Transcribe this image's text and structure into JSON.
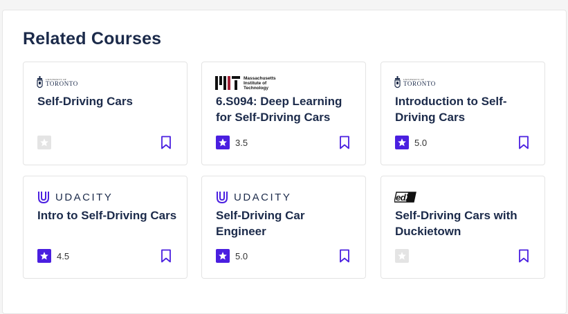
{
  "section": {
    "title": "Related Courses"
  },
  "colors": {
    "accent": "#4a1fe0",
    "title": "#1b2a4a",
    "empty_star": "#e4e4e4"
  },
  "courses": [
    {
      "provider": "University of Toronto",
      "logo": {
        "icon": "uoft-crest-icon",
        "small": "UNIVERSITY OF",
        "big": "TORONTO"
      },
      "title": "Self-Driving Cars",
      "rating": "",
      "rated": false
    },
    {
      "provider": "MIT",
      "logo": {
        "icon": "mit-logo-icon",
        "lines": [
          "Massachusetts",
          "Institute of",
          "Technology"
        ]
      },
      "title": "6.S094: Deep Learning for Self-Driving Cars",
      "rating": "3.5",
      "rated": true
    },
    {
      "provider": "University of Toronto",
      "logo": {
        "icon": "uoft-crest-icon",
        "small": "UNIVERSITY OF",
        "big": "TORONTO"
      },
      "title": "Introduction to Self-Driving Cars",
      "rating": "5.0",
      "rated": true
    },
    {
      "provider": "Udacity",
      "logo": {
        "icon": "udacity-u-icon",
        "text": "UDACITY"
      },
      "title": "Intro to Self-Driving Cars",
      "rating": "4.5",
      "rated": true
    },
    {
      "provider": "Udacity",
      "logo": {
        "icon": "udacity-u-icon",
        "text": "UDACITY"
      },
      "title": "Self-Driving Car Engineer",
      "rating": "5.0",
      "rated": true
    },
    {
      "provider": "edX",
      "logo": {
        "icon": "edx-logo-icon",
        "text": "edX"
      },
      "title": "Self-Driving Cars with Duckietown",
      "rating": "",
      "rated": false
    }
  ]
}
